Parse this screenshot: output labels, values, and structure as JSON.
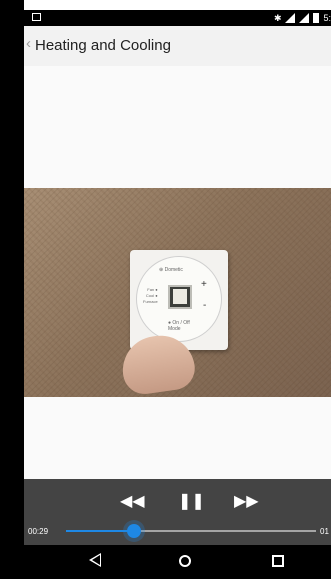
{
  "status_bar": {
    "time": "5:",
    "icons": [
      "image-notification-icon",
      "bluetooth-icon",
      "wifi-icon",
      "cell-signal-icon",
      "battery-icon"
    ]
  },
  "app_bar": {
    "back_icon": "chevron-left-icon",
    "title": "Heating and Cooling"
  },
  "video": {
    "subject": "thermostat",
    "overlay_text": {
      "brand": "⊕ Dometic",
      "mode": "● On / Off\nMode",
      "side_labels": "Fan ●\nCool ●\nFurnace"
    }
  },
  "player": {
    "rewind_icon": "rewind-icon",
    "pause_icon": "pause-icon",
    "fast_forward_icon": "fast-forward-icon",
    "current_time": "00:29",
    "total_time": "01",
    "progress_fraction": 0.27,
    "accent_color": "#1e88e5"
  },
  "nav_bar": {
    "icons": [
      "back-icon",
      "home-icon",
      "recent-apps-icon"
    ]
  }
}
